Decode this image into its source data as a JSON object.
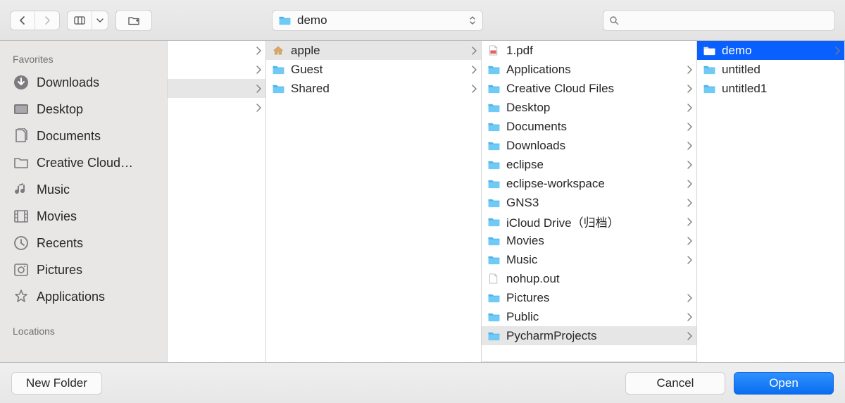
{
  "toolbar": {
    "path_label": "demo",
    "search_placeholder": ""
  },
  "sidebar": {
    "favorites_header": "Favorites",
    "locations_header": "Locations",
    "items": [
      {
        "label": "Downloads",
        "icon": "downloads"
      },
      {
        "label": "Desktop",
        "icon": "desktop"
      },
      {
        "label": "Documents",
        "icon": "documents"
      },
      {
        "label": "Creative Cloud…",
        "icon": "folder-gray"
      },
      {
        "label": "Music",
        "icon": "music"
      },
      {
        "label": "Movies",
        "icon": "movies"
      },
      {
        "label": "Recents",
        "icon": "recents"
      },
      {
        "label": "Pictures",
        "icon": "pictures"
      },
      {
        "label": "Applications",
        "icon": "applications"
      }
    ]
  },
  "columns": {
    "col0": [
      {
        "label": "",
        "nav": true,
        "blank": true
      },
      {
        "label": "",
        "nav": true,
        "blank": true
      },
      {
        "label": "",
        "nav": true,
        "blank": true,
        "selected": true
      },
      {
        "label": "",
        "nav": true,
        "blank": true
      }
    ],
    "col1": [
      {
        "label": "apple",
        "icon": "home",
        "nav": true,
        "selected": true
      },
      {
        "label": "Guest",
        "icon": "folder",
        "nav": true
      },
      {
        "label": "Shared",
        "icon": "folder",
        "nav": true
      }
    ],
    "col2": [
      {
        "label": "1.pdf",
        "icon": "pdf",
        "nav": false
      },
      {
        "label": "Applications",
        "icon": "folder-app",
        "nav": true
      },
      {
        "label": "Creative Cloud Files",
        "icon": "folder",
        "nav": true
      },
      {
        "label": "Desktop",
        "icon": "folder",
        "nav": true
      },
      {
        "label": "Documents",
        "icon": "folder",
        "nav": true
      },
      {
        "label": "Downloads",
        "icon": "folder-dl",
        "nav": true
      },
      {
        "label": "eclipse",
        "icon": "folder",
        "nav": true
      },
      {
        "label": "eclipse-workspace",
        "icon": "folder",
        "nav": true
      },
      {
        "label": "GNS3",
        "icon": "folder",
        "nav": true
      },
      {
        "label": "iCloud Drive（归档）",
        "icon": "folder",
        "nav": true
      },
      {
        "label": "Movies",
        "icon": "folder-mov",
        "nav": true
      },
      {
        "label": "Music",
        "icon": "folder-mus",
        "nav": true
      },
      {
        "label": "nohup.out",
        "icon": "file",
        "nav": false
      },
      {
        "label": "Pictures",
        "icon": "folder-pic",
        "nav": true
      },
      {
        "label": "Public",
        "icon": "folder-pub",
        "nav": true
      },
      {
        "label": "PycharmProjects",
        "icon": "folder",
        "nav": true,
        "selected": true
      }
    ],
    "col3": [
      {
        "label": "demo",
        "icon": "folder",
        "nav": true,
        "selectedblue": true
      },
      {
        "label": "untitled",
        "icon": "folder",
        "nav": false
      },
      {
        "label": "untitled1",
        "icon": "folder",
        "nav": false
      }
    ]
  },
  "footer": {
    "new_folder": "New Folder",
    "cancel": "Cancel",
    "open": "Open"
  }
}
